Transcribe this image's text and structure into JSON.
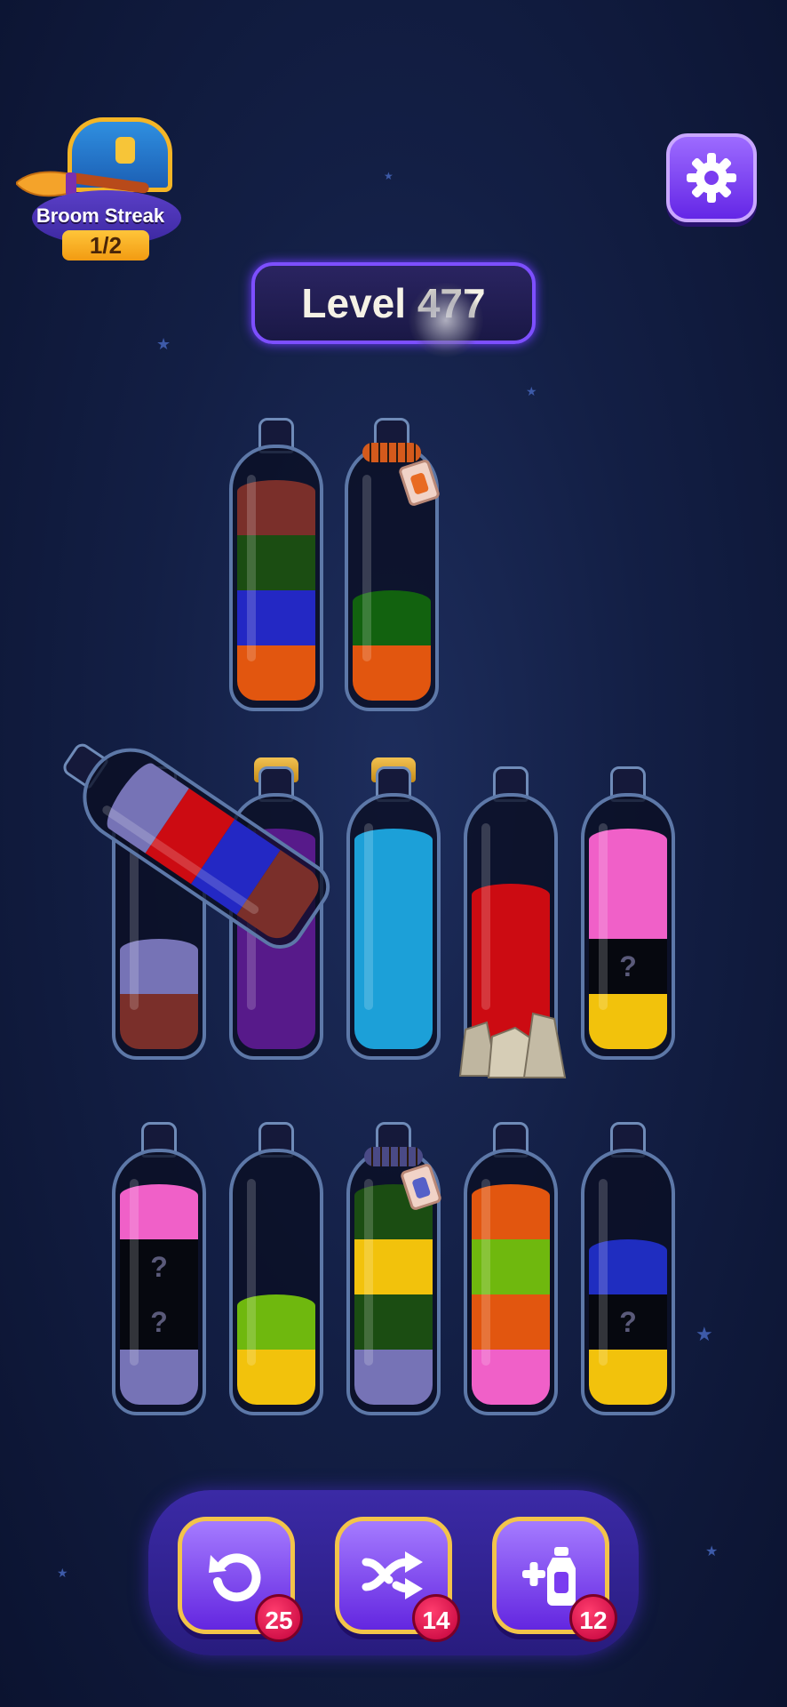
{
  "header": {
    "streak_label": "Broom Streak",
    "streak_count": "1/2",
    "level_label": "Level 477"
  },
  "colors": {
    "brown": "#7a2f2a",
    "darkgreen": "#1b4d12",
    "green": "#12620f",
    "blue": "#2328c4",
    "orange": "#e2560f",
    "lavender": "#7673b6",
    "purple": "#571a8a",
    "cyan": "#1ca0d8",
    "red": "#cc0b12",
    "pink": "#f060c8",
    "hidden": "#06080f",
    "yellow": "#f2c20c",
    "lime": "#6fb80e",
    "navy": "#1f2dc0"
  },
  "bottles": [
    {
      "row": 1,
      "layers": [
        "orange",
        "blue",
        "darkgreen",
        "brown"
      ]
    },
    {
      "row": 1,
      "layers": [
        "orange",
        "green"
      ],
      "locked": true,
      "rope_color": "#d45a1c",
      "tag_color": "#e86a22"
    },
    {
      "row": 2,
      "layers": [
        "brown",
        "lavender"
      ]
    },
    {
      "row": 2,
      "layers": [
        "purple",
        "purple",
        "purple",
        "purple"
      ],
      "corked": true
    },
    {
      "row": 2,
      "layers": [
        "cyan",
        "cyan",
        "cyan",
        "cyan"
      ],
      "corked": true
    },
    {
      "row": 2,
      "layers": [
        "red",
        "red",
        "red"
      ],
      "rocks": true
    },
    {
      "row": 2,
      "layers": [
        "yellow",
        "hidden",
        "pink",
        "pink"
      ],
      "hidden_marker": "?"
    },
    {
      "row": 3,
      "layers": [
        "lavender",
        "hidden",
        "hidden",
        "pink"
      ],
      "hidden_marker": "?"
    },
    {
      "row": 3,
      "layers": [
        "yellow",
        "lime"
      ]
    },
    {
      "row": 3,
      "layers": [
        "lavender",
        "darkgreen",
        "yellow",
        "darkgreen"
      ],
      "locked": true,
      "rope_color": "#4a4a86",
      "tag_color": "#5560c8"
    },
    {
      "row": 3,
      "layers": [
        "pink",
        "orange",
        "lime",
        "orange"
      ]
    },
    {
      "row": 3,
      "layers": [
        "yellow",
        "hidden",
        "navy"
      ],
      "hidden_marker": "?"
    }
  ],
  "pouring_bottle": {
    "layers": [
      "brown",
      "blue",
      "red",
      "lavender"
    ]
  },
  "tools": [
    {
      "name": "undo",
      "count": "25"
    },
    {
      "name": "shuffle",
      "count": "14"
    },
    {
      "name": "add-bottle",
      "count": "12"
    }
  ]
}
